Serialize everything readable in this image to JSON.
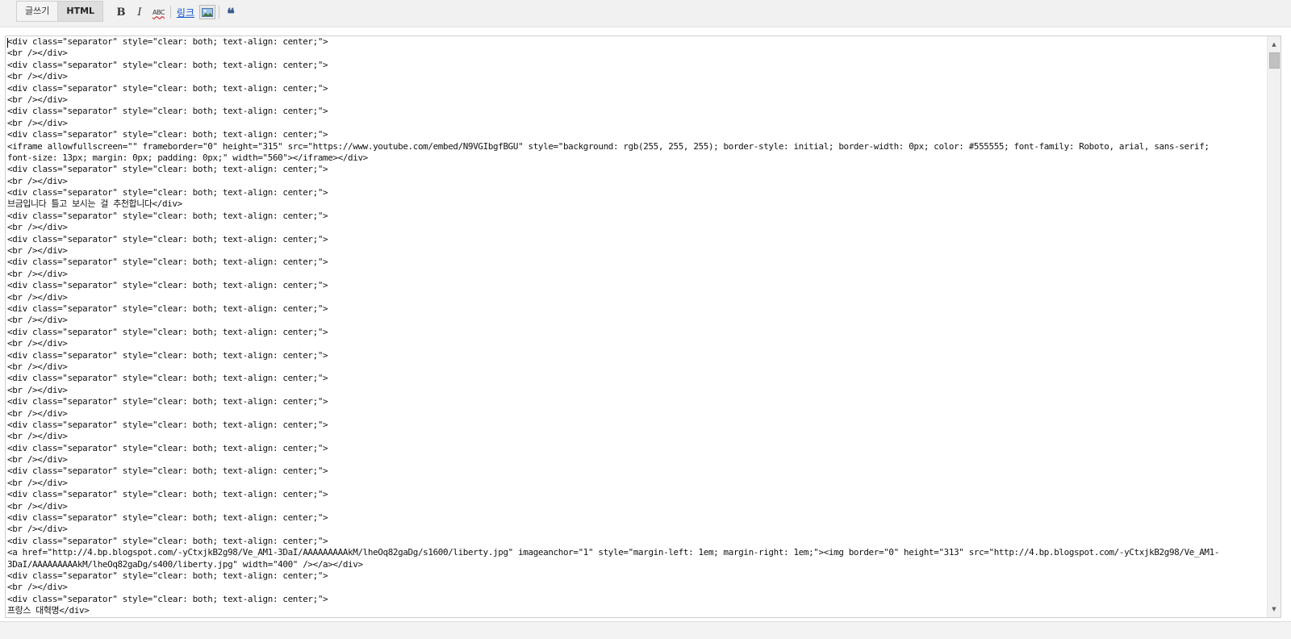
{
  "toolbar": {
    "tabs": [
      "글쓰기",
      "HTML"
    ],
    "active_tab": "HTML",
    "bold_label": "B",
    "italic_label": "I",
    "spell_label": "ABC",
    "link_label": "링크",
    "image_icon": "image-icon",
    "quote_label": "❝"
  },
  "editor": {
    "lines": [
      "<div class=\"separator\" style=\"clear: both; text-align: center;\">",
      "<br /></div>",
      "<div class=\"separator\" style=\"clear: both; text-align: center;\">",
      "<br /></div>",
      "<div class=\"separator\" style=\"clear: both; text-align: center;\">",
      "<br /></div>",
      "<div class=\"separator\" style=\"clear: both; text-align: center;\">",
      "<br /></div>",
      "<div class=\"separator\" style=\"clear: both; text-align: center;\">",
      "<iframe allowfullscreen=\"\" frameborder=\"0\" height=\"315\" src=\"https://www.youtube.com/embed/N9VGIbgfBGU\" style=\"background: rgb(255, 255, 255); border-style: initial; border-width: 0px; color: #555555; font-family: Roboto, arial, sans-serif;",
      "font-size: 13px; margin: 0px; padding: 0px;\" width=\"560\"></iframe></div>",
      "<div class=\"separator\" style=\"clear: both; text-align: center;\">",
      "<br /></div>",
      "<div class=\"separator\" style=\"clear: both; text-align: center;\">",
      "브금입니다 틀고 보시는 걸 추천합니다</div>",
      "<div class=\"separator\" style=\"clear: both; text-align: center;\">",
      "<br /></div>",
      "<div class=\"separator\" style=\"clear: both; text-align: center;\">",
      "<br /></div>",
      "<div class=\"separator\" style=\"clear: both; text-align: center;\">",
      "<br /></div>",
      "<div class=\"separator\" style=\"clear: both; text-align: center;\">",
      "<br /></div>",
      "<div class=\"separator\" style=\"clear: both; text-align: center;\">",
      "<br /></div>",
      "<div class=\"separator\" style=\"clear: both; text-align: center;\">",
      "<br /></div>",
      "<div class=\"separator\" style=\"clear: both; text-align: center;\">",
      "<br /></div>",
      "<div class=\"separator\" style=\"clear: both; text-align: center;\">",
      "<br /></div>",
      "<div class=\"separator\" style=\"clear: both; text-align: center;\">",
      "<br /></div>",
      "<div class=\"separator\" style=\"clear: both; text-align: center;\">",
      "<br /></div>",
      "<div class=\"separator\" style=\"clear: both; text-align: center;\">",
      "<br /></div>",
      "<div class=\"separator\" style=\"clear: both; text-align: center;\">",
      "<br /></div>",
      "<div class=\"separator\" style=\"clear: both; text-align: center;\">",
      "<br /></div>",
      "<div class=\"separator\" style=\"clear: both; text-align: center;\">",
      "<br /></div>",
      "<div class=\"separator\" style=\"clear: both; text-align: center;\">",
      "<a href=\"http://4.bp.blogspot.com/-yCtxjkB2g98/Ve_AM1-3DaI/AAAAAAAAAkM/lheOq82gaDg/s1600/liberty.jpg\" imageanchor=\"1\" style=\"margin-left: 1em; margin-right: 1em;\"><img border=\"0\" height=\"313\" src=\"http://4.bp.blogspot.com/-yCtxjkB2g98/Ve_AM1-",
      "3DaI/AAAAAAAAAkM/lheOq82gaDg/s400/liberty.jpg\" width=\"400\" /></a></div>",
      "<div class=\"separator\" style=\"clear: both; text-align: center;\">",
      "<br /></div>",
      "<div class=\"separator\" style=\"clear: both; text-align: center;\">",
      "프랑스 대혁명</div>"
    ]
  }
}
